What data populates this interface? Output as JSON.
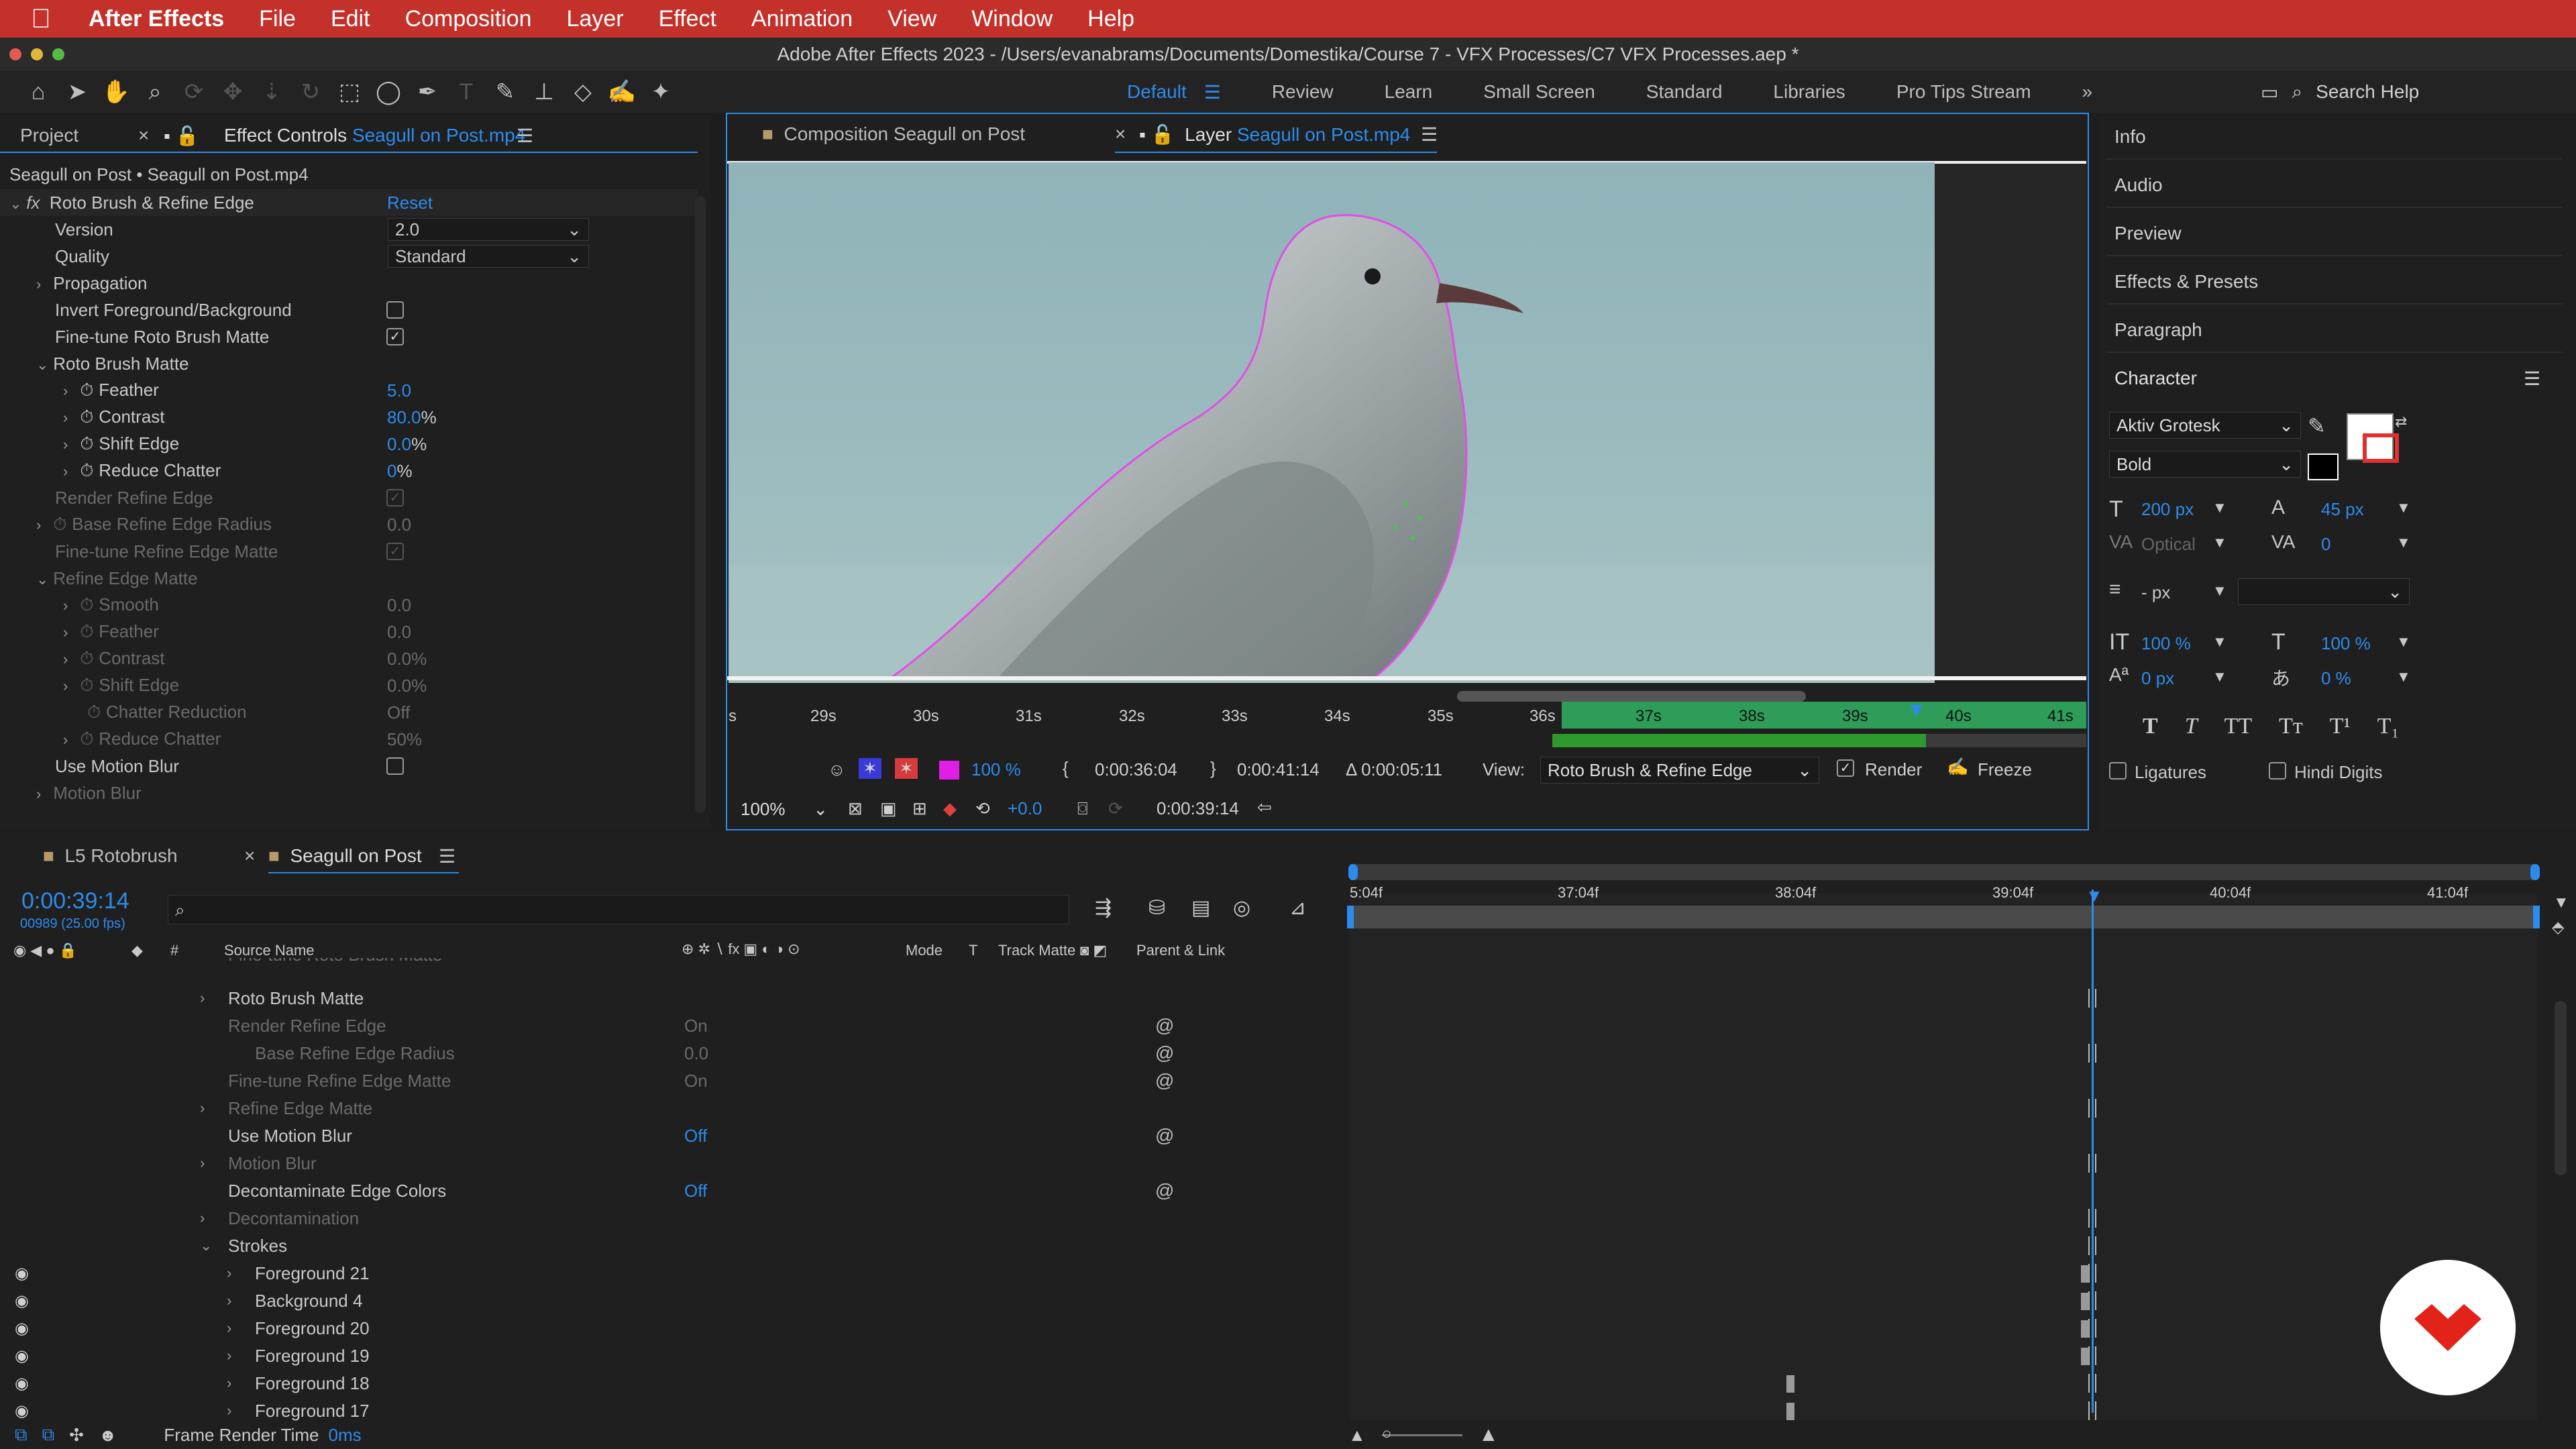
{
  "menubar": {
    "app": "After Effects",
    "items": [
      "File",
      "Edit",
      "Composition",
      "Layer",
      "Effect",
      "Animation",
      "View",
      "Window",
      "Help"
    ]
  },
  "window": {
    "title": "Adobe After Effects 2023 - /Users/evanabrams/Documents/Domestika/Course 7 - VFX Processes/C7 VFX Processes.aep *"
  },
  "toolbar": {
    "workspaces": [
      "Default",
      "Review",
      "Learn",
      "Small Screen",
      "Standard",
      "Libraries",
      "Pro Tips Stream"
    ],
    "search_placeholder": "Search Help"
  },
  "effect_controls": {
    "tab_project": "Project",
    "tab_label": "Effect Controls",
    "tab_layer": "Seagull on Post.mp4",
    "layer_path": "Seagull on Post • Seagull on Post.mp4",
    "effect_name": "Roto Brush & Refine Edge",
    "reset": "Reset",
    "version_label": "Version",
    "version_value": "2.0",
    "quality_label": "Quality",
    "quality_value": "Standard",
    "propagation": "Propagation",
    "invert": "Invert Foreground/Background",
    "finetune_roto": "Fine-tune Roto Brush Matte",
    "roto_matte": "Roto Brush Matte",
    "feather": "Feather",
    "feather_val": "5.0",
    "contrast": "Contrast",
    "contrast_val": "80.0",
    "pct": "%",
    "shift_edge": "Shift Edge",
    "shift_edge_val": "0.0",
    "reduce_chatter": "Reduce Chatter",
    "reduce_chatter_val": "0",
    "render_refine": "Render Refine Edge",
    "base_refine": "Base Refine Edge Radius",
    "base_refine_val": "0.0",
    "finetune_refine": "Fine-tune Refine Edge Matte",
    "refine_matte": "Refine Edge Matte",
    "smooth": "Smooth",
    "smooth_val": "0.0",
    "r_feather": "Feather",
    "r_feather_val": "0.0",
    "r_contrast": "Contrast",
    "r_contrast_val": "0.0%",
    "r_shift": "Shift Edge",
    "r_shift_val": "0.0%",
    "chatter_reduction": "Chatter Reduction",
    "chatter_reduction_val": "Off",
    "r_reduce": "Reduce Chatter",
    "r_reduce_val": "50%",
    "use_motion_blur": "Use Motion Blur",
    "motion_blur": "Motion Blur"
  },
  "viewer": {
    "tab_comp_label": "Composition",
    "tab_comp": "Seagull on Post",
    "tab_layer_label": "Layer",
    "tab_layer": "Seagull on Post.mp4",
    "ruler": [
      "s",
      "29s",
      "30s",
      "31s",
      "32s",
      "33s",
      "34s",
      "35s",
      "36s",
      "37s",
      "38s",
      "39s",
      "40s",
      "41s"
    ],
    "zoom": "100 %",
    "in_time": "0:00:36:04",
    "out_time": "0:00:41:14",
    "duration": "Δ 0:00:05:11",
    "view_label": "View:",
    "view_value": "Roto Brush & Refine Edge",
    "render": "Render",
    "freeze": "Freeze",
    "magnification": "100%",
    "exposure": "+0.0",
    "current_time": "0:00:39:14"
  },
  "right_panels": {
    "items": [
      "Info",
      "Audio",
      "Preview",
      "Effects & Presets",
      "Paragraph"
    ],
    "character": "Character",
    "font": "Aktiv Grotesk",
    "style": "Bold",
    "font_size": "200 px",
    "leading": "45 px",
    "kerning": "Optical",
    "tracking": "0",
    "stroke": "- px",
    "vscale": "100 %",
    "hscale": "100 %",
    "baseline": "0 px",
    "tsume": "0 %",
    "ligatures": "Ligatures",
    "hindi": "Hindi Digits",
    "styles": [
      "T",
      "T",
      "TT",
      "Tт",
      "T¹",
      "T₁"
    ]
  },
  "timeline": {
    "tab1": "L5 Rotobrush",
    "tab2": "Seagull on Post",
    "timecode": "0:00:39:14",
    "frames": "00989 (25.00 fps)",
    "columns": {
      "source": "Source Name",
      "mode": "Mode",
      "t": "T",
      "track": "Track Matte",
      "parent": "Parent & Link"
    },
    "ruler": [
      "5:04f",
      "37:04f",
      "38:04f",
      "39:04f",
      "40:04f",
      "41:04f"
    ],
    "cut_row": "Fine-tune Roto Brush Matte",
    "rows": [
      {
        "name": "Roto Brush Matte",
        "value": "",
        "dim": false,
        "chev": true,
        "indent": 0
      },
      {
        "name": "Render Refine Edge",
        "value": "On",
        "dim": true,
        "chev": false,
        "indent": 0,
        "spiral": true
      },
      {
        "name": "Base Refine Edge Radius",
        "value": "0.0",
        "dim": true,
        "chev": false,
        "indent": 1,
        "spiral": true
      },
      {
        "name": "Fine-tune Refine Edge Matte",
        "value": "On",
        "dim": true,
        "chev": false,
        "indent": 0,
        "spiral": true
      },
      {
        "name": "Refine Edge Matte",
        "value": "",
        "dim": true,
        "chev": true,
        "indent": 0
      },
      {
        "name": "Use Motion Blur",
        "value": "Off",
        "dim": false,
        "chev": false,
        "indent": 0,
        "spiral": true
      },
      {
        "name": "Motion Blur",
        "value": "",
        "dim": true,
        "chev": true,
        "indent": 0
      },
      {
        "name": "Decontaminate Edge Colors",
        "value": "Off",
        "dim": false,
        "chev": false,
        "indent": 0,
        "spiral": true
      },
      {
        "name": "Decontamination",
        "value": "",
        "dim": true,
        "chev": true,
        "indent": 0
      },
      {
        "name": "Strokes",
        "value": "",
        "dim": false,
        "chev": true,
        "indent": 0,
        "open": true
      },
      {
        "name": "Foreground 21",
        "value": "",
        "dim": false,
        "chev": true,
        "indent": 1,
        "eye": true
      },
      {
        "name": "Background 4",
        "value": "",
        "dim": false,
        "chev": true,
        "indent": 1,
        "eye": true
      },
      {
        "name": "Foreground 20",
        "value": "",
        "dim": false,
        "chev": true,
        "indent": 1,
        "eye": true
      },
      {
        "name": "Foreground 19",
        "value": "",
        "dim": false,
        "chev": true,
        "indent": 1,
        "eye": true
      },
      {
        "name": "Foreground 18",
        "value": "",
        "dim": false,
        "chev": true,
        "indent": 1,
        "eye": true
      },
      {
        "name": "Foreground 17",
        "value": "",
        "dim": false,
        "chev": true,
        "indent": 1,
        "eye": true
      }
    ],
    "status_label": "Frame Render Time",
    "status_value": "0ms"
  }
}
